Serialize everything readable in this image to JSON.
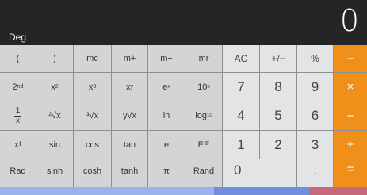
{
  "display": {
    "mode": "Deg",
    "value": "0"
  },
  "keys": {
    "r1": [
      "(",
      ")",
      "mc",
      "m+",
      "m−",
      "mr",
      "AC",
      "+/−",
      "%",
      "−"
    ],
    "r2": [
      "2nd",
      "x2",
      "x3",
      "xy",
      "ex",
      "10x",
      "7",
      "8",
      "9",
      "×"
    ],
    "r3": [
      "1/x",
      "²√x",
      "³√x",
      "y√x",
      "ln",
      "log10",
      "4",
      "5",
      "6",
      "−"
    ],
    "r4": [
      "x!",
      "sin",
      "cos",
      "tan",
      "e",
      "EE",
      "1",
      "2",
      "3",
      "+"
    ],
    "r5": [
      "Rad",
      "sinh",
      "cosh",
      "tanh",
      "π",
      "Rand",
      "0",
      ".",
      "="
    ]
  },
  "colors": {
    "operator": "#f0901b",
    "scientific_key": "#d3d4d5",
    "number_key": "#e3e4e5",
    "display_bg": "#252525"
  }
}
